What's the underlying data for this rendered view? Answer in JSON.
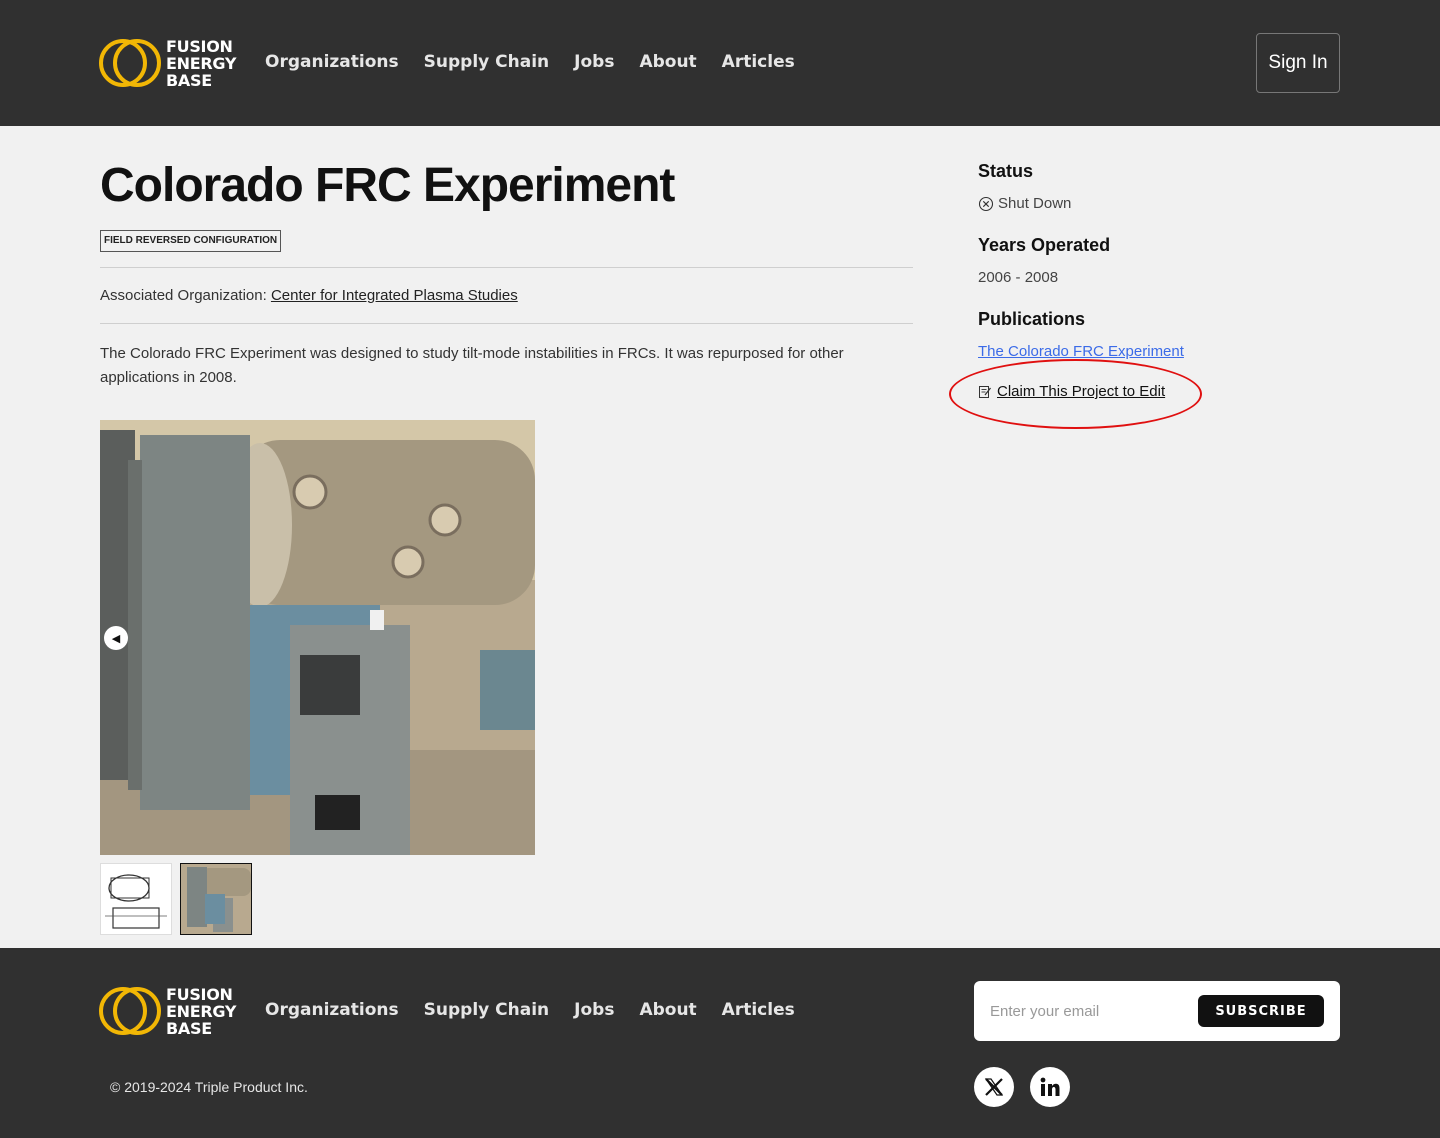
{
  "brand": {
    "line1": "FUSION",
    "line2": "ENERGY",
    "line3": "BASE",
    "ring_color": "#f2b705"
  },
  "nav": {
    "items": [
      "Organizations",
      "Supply Chain",
      "Jobs",
      "About",
      "Articles"
    ]
  },
  "header": {
    "signin_label": "Sign In"
  },
  "project": {
    "title": "Colorado FRC Experiment",
    "tag": "FIELD REVERSED CONFIGURATION",
    "assoc_label": "Associated Organization:",
    "assoc_org": "Center for Integrated Plasma Studies",
    "description": "The Colorado FRC Experiment was designed to study tilt-mode instabilities  in FRCs. It was repurposed for other applications in 2008."
  },
  "gallery": {
    "prev_icon": "chevron-left-icon",
    "thumb_count": 2,
    "selected_thumb": 2
  },
  "sidebar": {
    "status_heading": "Status",
    "status_value": "Shut Down",
    "status_icon": "circle-x-icon",
    "years_heading": "Years Operated",
    "years_value": "2006 - 2008",
    "pubs_heading": "Publications",
    "publication": "The Colorado FRC Experiment",
    "claim_label": "Claim This Project to Edit",
    "claim_icon": "edit-note-icon",
    "annotation_color": "#e01010"
  },
  "footer": {
    "email_placeholder": "Enter your email",
    "subscribe_label": "SUBSCRIBE",
    "copyright": "© 2019-2024 Triple Product Inc.",
    "social": [
      "x-icon",
      "linkedin-icon"
    ]
  },
  "colors": {
    "header_bg": "#303030",
    "page_bg": "#f1f1f1",
    "link_blue": "#3b6be8"
  }
}
